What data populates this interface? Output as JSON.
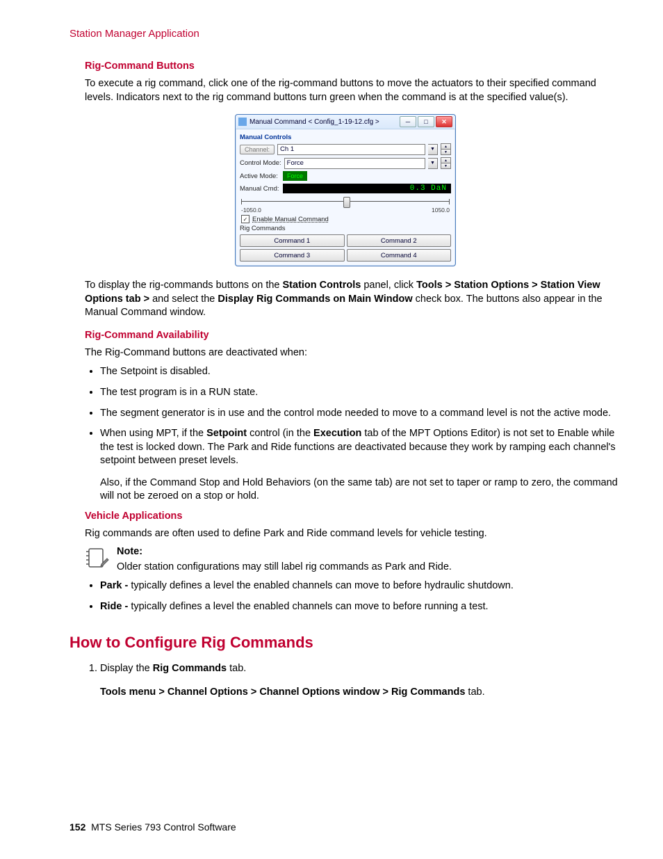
{
  "header": "Station Manager Application",
  "sections": {
    "rig_command_buttons": {
      "heading": "Rig-Command Buttons",
      "para1": "To execute a rig command, click one of the rig-command buttons to move the actuators to their specified command levels. Indicators next to the rig command buttons turn green when the command is at the specified value(s).",
      "para2_pre": "To display the rig-commands buttons on the ",
      "para2_b1": "Station Controls",
      "para2_mid1": " panel, click ",
      "para2_b2": "Tools > Station Options > Station View Options tab >",
      "para2_mid2": " and select the ",
      "para2_b3": "Display Rig Commands on Main Window",
      "para2_end": " check box. The buttons also appear in the Manual Command window."
    },
    "availability": {
      "heading": "Rig-Command Availability",
      "intro": "The Rig-Command buttons are deactivated when:",
      "b1": "The Setpoint is disabled.",
      "b2": "The test program is in a RUN state.",
      "b3": "The segment generator is in use and the control mode needed to move to a command level is not the active mode.",
      "b4_pre": "When using MPT, if the ",
      "b4_b1": "Setpoint",
      "b4_mid1": " control (in the ",
      "b4_b2": "Execution",
      "b4_end": " tab of the MPT Options Editor) is not set to Enable while the test is locked down. The Park and Ride functions are deactivated because they work by ramping each channel's setpoint between preset levels.",
      "b4_sub": "Also, if the Command Stop and Hold Behaviors (on the same tab) are not set to taper or ramp to zero, the command will not be zeroed on a stop or hold."
    },
    "vehicle": {
      "heading": "Vehicle Applications",
      "intro": "Rig commands are often used to define Park and Ride command levels for vehicle testing.",
      "note_label": "Note:",
      "note_body": "Older station configurations may still label rig commands as Park and Ride.",
      "b1_b": "Park - ",
      "b1": " typically defines a level the enabled channels can move to before hydraulic shutdown.",
      "b2_b": "Ride - ",
      "b2": "typically defines a level the enabled channels can move to before running a test."
    },
    "howto": {
      "heading": "How to Configure Rig Commands",
      "step1_pre": "Display the ",
      "step1_b": "Rig Commands",
      "step1_post": " tab.",
      "step1_path_b": "Tools menu > Channel Options > Channel Options window > Rig Commands",
      "step1_path_post": " tab."
    }
  },
  "window": {
    "title": "Manual Command < Config_1-19-12.cfg >",
    "group_label": "Manual Controls",
    "channel_btn": "Channel:",
    "channel_value": "Ch 1",
    "control_mode_label": "Control Mode:",
    "control_mode_value": "Force",
    "active_mode_label": "Active Mode:",
    "active_mode_value": "Force",
    "manual_cmd_label": "Manual Cmd:",
    "manual_cmd_value": "0.3 DaN",
    "slider_min": "-1050.0",
    "slider_max": "1050.0",
    "enable_checkbox": "Enable Manual Command",
    "rig_group": "Rig Commands",
    "cmd1": "Command 1",
    "cmd2": "Command 2",
    "cmd3": "Command 3",
    "cmd4": "Command 4"
  },
  "footer": {
    "page": "152",
    "title": "MTS Series 793 Control Software"
  }
}
